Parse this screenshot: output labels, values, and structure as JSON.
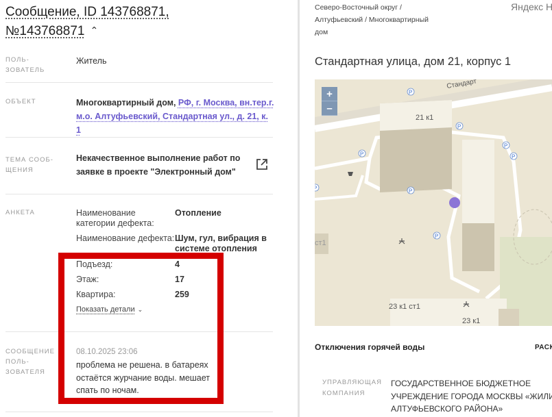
{
  "left": {
    "title_part1": "Сообщение, ID 143768871,",
    "title_part2": "№143768871",
    "user_label_1": "ПОЛЬ-",
    "user_label_2": "ЗОВАТЕЛЬ",
    "user_value": "Житель",
    "object_label": "ОБЪЕКТ",
    "object_value_bold": "Многоквартирный дом,",
    "object_link_1": "РФ, г. Москва, вн.тер.г.",
    "object_link_2": "м.о. Алтуфьевский, Стандартная ул., д. 21, к. 1",
    "topic_label_1": "ТЕМА СООБ-",
    "topic_label_2": "ЩЕНИЯ",
    "topic_value_1": "Некачественное выполнение работ по",
    "topic_value_2": "заявке в проекте \"Электронный дом\"",
    "survey_label": "АНКЕТА",
    "survey": {
      "cat_key_1": "Наименование",
      "cat_key_2": "категории дефекта:",
      "cat_val": "Отопление",
      "def_key": "Наименование дефекта:",
      "def_val_1": "Шум, гул, вибрация в",
      "def_val_2": "системе отопления",
      "entrance_key": "Подъезд:",
      "entrance_val": "4",
      "floor_key": "Этаж:",
      "floor_val": "17",
      "apt_key": "Квартира:",
      "apt_val": "259",
      "details_link": "Показать детали"
    },
    "message_label_1": "СООБЩЕНИЕ",
    "message_label_2": "ПОЛЬ-",
    "message_label_3": "ЗОВАТЕЛЯ",
    "message_date": "08.10.2025 23:06",
    "message_text": "проблема не решена. в батареях остаётся журчание воды. мешает спать по ночам."
  },
  "right": {
    "breadcrumb_1": "Северо-Восточный округ /",
    "breadcrumb_2": "Алтуфьевский / Многоквартирный",
    "breadcrumb_3": "дом",
    "yandex": "Яндекс Н",
    "address": "Стандартная улица, дом 21, корпус 1",
    "map": {
      "zoom_in": "+",
      "zoom_out": "–",
      "street_label": "Стандарт",
      "bld_21k1": "21 к1",
      "bld_23k1st1": "23 к1 ст1",
      "bld_23k1": "23 к1",
      "bld_st1": "ст1",
      "parking": "P",
      "marker_color": "#8b74d6"
    },
    "outage_title": "Отключения горячей воды",
    "outage_tab": "РАСК",
    "uk_label_1": "УПРАВЛЯЮЩАЯ",
    "uk_label_2": "КОМПАНИЯ",
    "uk_value_1": "ГОСУДАРСТВЕННОЕ БЮДЖЕТНОЕ",
    "uk_value_2": "УЧРЕЖДЕНИЕ ГОРОДА МОСКВЫ «ЖИЛИ",
    "uk_value_3": "АЛТУФЬЕВСКОГО РАЙОНА»"
  },
  "colors": {
    "highlight": "#d40000",
    "link": "#6a5acd",
    "map_bg": "#ece6d4"
  }
}
